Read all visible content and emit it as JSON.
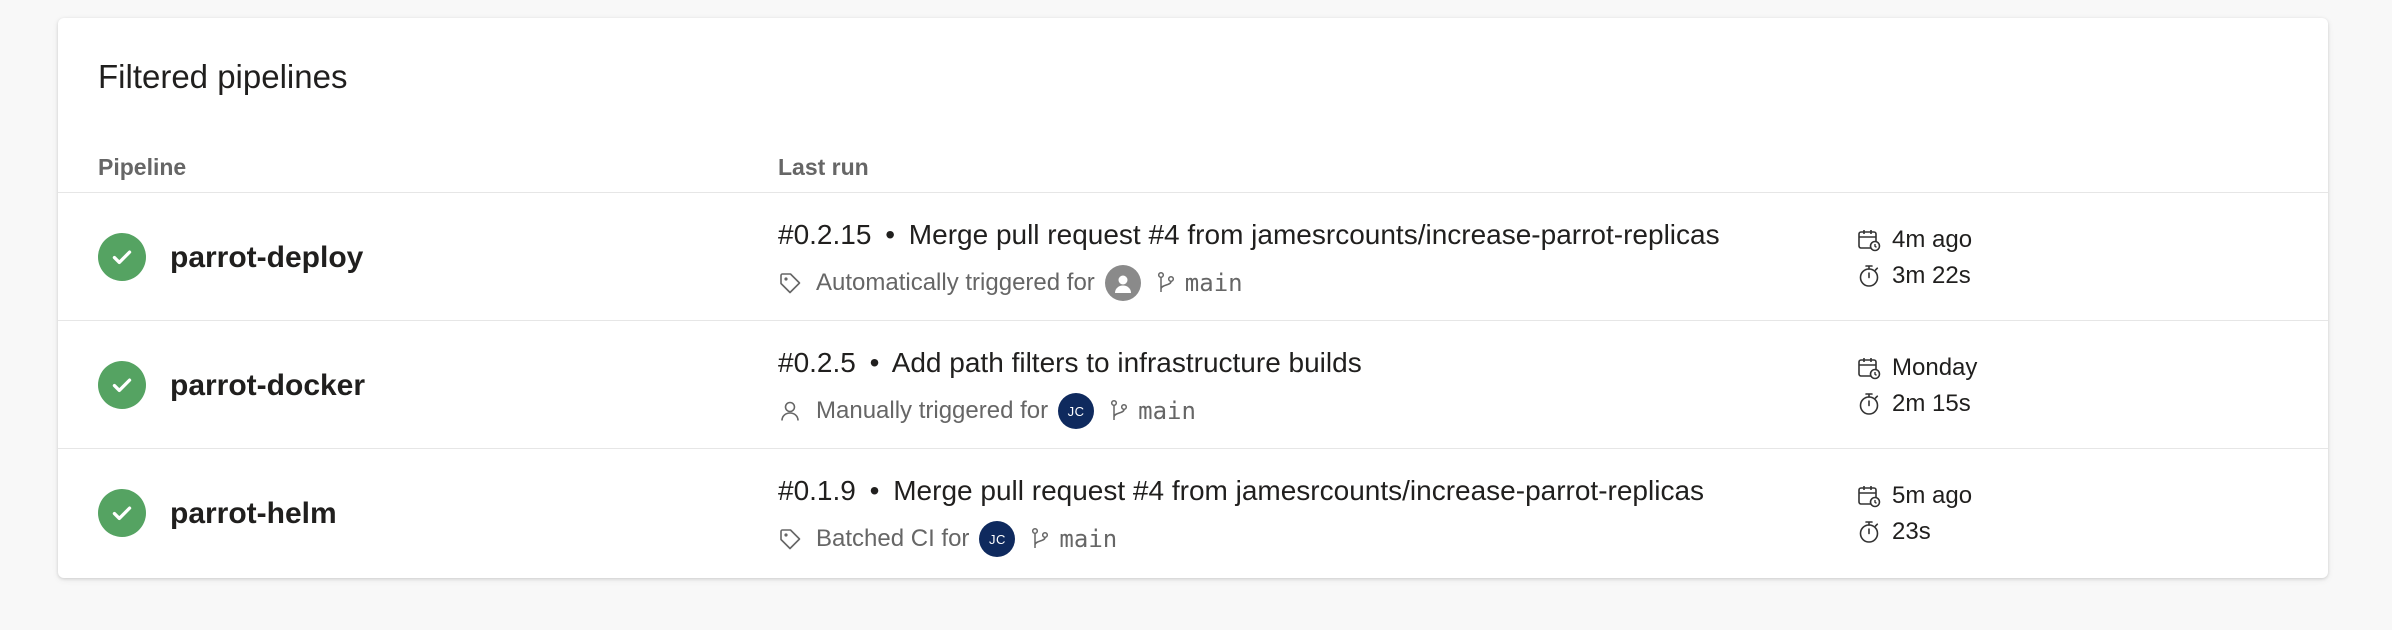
{
  "card": {
    "title": "Filtered pipelines",
    "columns": {
      "pipeline": "Pipeline",
      "last_run": "Last run"
    }
  },
  "pipelines": [
    {
      "name": "parrot-deploy",
      "status": "succeeded",
      "run_number": "#0.2.15",
      "separator": "•",
      "commit_message": "Merge pull request #4 from jamesrcounts/increase-parrot-replicas",
      "reason": "Automatically triggered for",
      "reason_icon": "tag-icon",
      "avatar": {
        "type": "default",
        "initials": ""
      },
      "branch": "main",
      "when": "4m ago",
      "duration": "3m 22s"
    },
    {
      "name": "parrot-docker",
      "status": "succeeded",
      "run_number": "#0.2.5",
      "separator": "•",
      "commit_message": "Add path filters to infrastructure builds",
      "reason": "Manually triggered for",
      "reason_icon": "person-icon",
      "avatar": {
        "type": "initials",
        "initials": "JC"
      },
      "branch": "main",
      "when": "Monday",
      "duration": "2m 15s"
    },
    {
      "name": "parrot-helm",
      "status": "succeeded",
      "run_number": "#0.1.9",
      "separator": "•",
      "commit_message": "Merge pull request #4 from jamesrcounts/increase-parrot-replicas",
      "reason": "Batched CI for",
      "reason_icon": "tag-icon",
      "avatar": {
        "type": "initials",
        "initials": "JC"
      },
      "branch": "main",
      "when": "5m ago",
      "duration": "23s"
    }
  ],
  "colors": {
    "success": "#55a362",
    "avatar_initials_bg": "#0f2a5e",
    "muted_text": "#666666"
  }
}
